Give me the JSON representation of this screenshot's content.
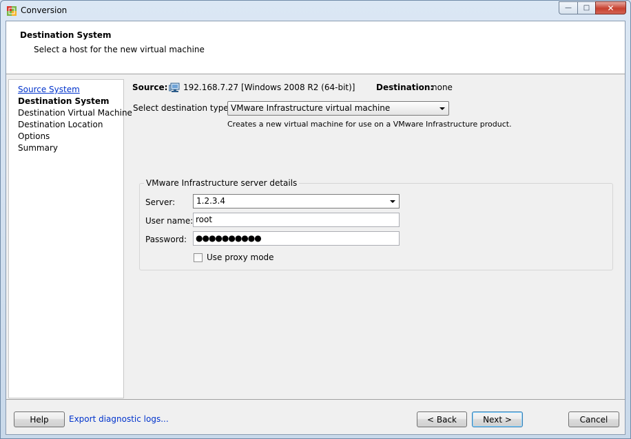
{
  "window": {
    "title": "Conversion",
    "minimize_glyph": "—",
    "maximize_glyph": "□",
    "close_glyph": "✕"
  },
  "header": {
    "title": "Destination System",
    "subtitle": "Select a host for the new virtual machine"
  },
  "steps": [
    {
      "label": "Source System",
      "state": "link"
    },
    {
      "label": "Destination System",
      "state": "current"
    },
    {
      "label": "Destination Virtual Machine",
      "state": "pending"
    },
    {
      "label": "Destination Location",
      "state": "pending"
    },
    {
      "label": "Options",
      "state": "pending"
    },
    {
      "label": "Summary",
      "state": "pending"
    }
  ],
  "main": {
    "source_label": "Source:",
    "source_value": "192.168.7.27 [Windows 2008 R2 (64-bit)]",
    "destination_label": "Destination:",
    "destination_value": "none",
    "dest_type_label": "Select destination type:",
    "dest_type_value": "VMware Infrastructure virtual machine",
    "dest_type_hint": "Creates a new virtual machine for use on a VMware Infrastructure product."
  },
  "server_details": {
    "legend": "VMware Infrastructure server details",
    "server_label": "Server:",
    "server_value": "1.2.3.4",
    "username_label": "User name:",
    "username_value": "root",
    "password_label": "Password:",
    "password_value": "●●●●●●●●●●",
    "proxy_label": "Use proxy mode",
    "proxy_checked": false
  },
  "footer": {
    "help_label": "Help",
    "export_logs_label": "Export diagnostic logs...",
    "back_label": "< Back",
    "next_label": "Next >",
    "cancel_label": "Cancel"
  },
  "icons": {
    "app": "conversion-app-icon",
    "source": "monitor-icon"
  },
  "colors": {
    "link": "#0033cc",
    "window_frame": "#dbe7f4",
    "close_button": "#c7402f"
  }
}
